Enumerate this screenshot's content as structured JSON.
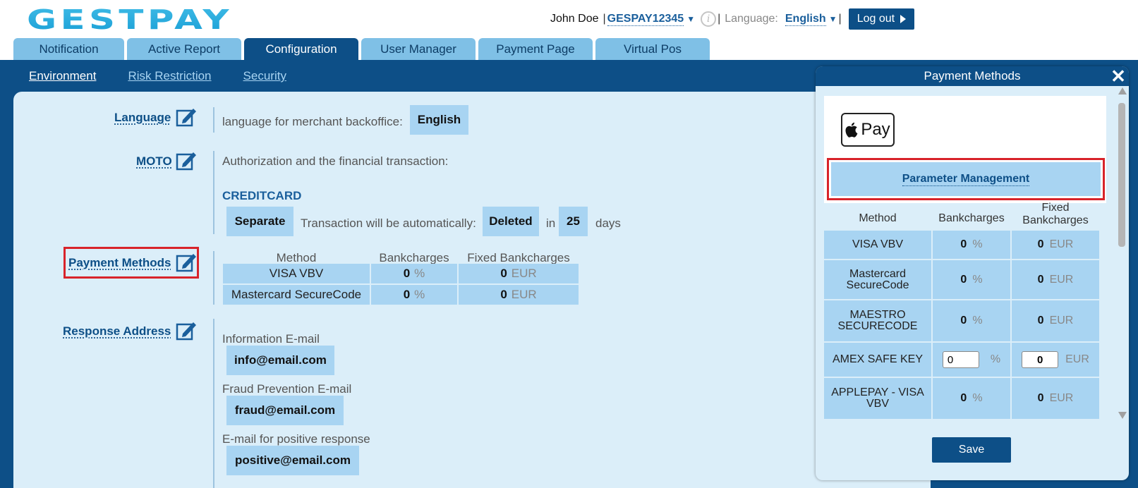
{
  "header": {
    "logo_text": "GESTPAY",
    "user_name": "John Doe",
    "shop_code": "GESPAY12345",
    "language_label": "Language:",
    "language_value": "English",
    "logout_label": "Log out"
  },
  "tabs": [
    {
      "label": "Notification"
    },
    {
      "label": "Active Report"
    },
    {
      "label": "Configuration"
    },
    {
      "label": "User Manager"
    },
    {
      "label": "Payment Page"
    },
    {
      "label": "Virtual Pos"
    }
  ],
  "subnav": [
    {
      "label": "Environment"
    },
    {
      "label": "Risk Restriction"
    },
    {
      "label": "Security"
    }
  ],
  "sections": {
    "language": {
      "label": "Language",
      "description": "language for merchant backoffice:",
      "value": "English"
    },
    "moto": {
      "label": "MOTO",
      "description": "Authorization and the financial transaction:",
      "subtitle": "CREDITCARD",
      "mode": "Separate",
      "auto_text": "Transaction will be automatically:",
      "action": "Deleted",
      "in_text": "in",
      "days_value": "25",
      "days_text": "days"
    },
    "payment_methods": {
      "label": "Payment Methods",
      "headers": [
        "Method",
        "Bankcharges",
        "Fixed Bankcharges"
      ],
      "rows": [
        {
          "method": "VISA VBV",
          "charge": "0",
          "charge_unit": "%",
          "fixed": "0",
          "fixed_unit": "EUR"
        },
        {
          "method": "Mastercard SecureCode",
          "charge": "0",
          "charge_unit": "%",
          "fixed": "0",
          "fixed_unit": "EUR"
        }
      ]
    },
    "response_address": {
      "label": "Response Address",
      "info_label": "Information E-mail",
      "info_value": "info@email.com",
      "fraud_label": "Fraud Prevention E-mail",
      "fraud_value": "fraud@email.com",
      "positive_label": "E-mail for positive response",
      "positive_value": "positive@email.com"
    }
  },
  "modal": {
    "title": "Payment Methods",
    "close": "✕",
    "applepay_label": "Pay",
    "param_button": "Parameter Management",
    "headers": {
      "method": "Method",
      "bankcharges": "Bankcharges",
      "fixed": "Fixed Bankcharges"
    },
    "rows": [
      {
        "method": "VISA VBV",
        "charge": "0",
        "charge_unit": "%",
        "fixed": "0",
        "fixed_unit": "EUR"
      },
      {
        "method": "Mastercard SecureCode",
        "charge": "0",
        "charge_unit": "%",
        "fixed": "0",
        "fixed_unit": "EUR"
      },
      {
        "method": "MAESTRO SECURECODE",
        "charge": "0",
        "charge_unit": "%",
        "fixed": "0",
        "fixed_unit": "EUR"
      },
      {
        "method": "AMEX SAFE KEY",
        "charge": "0",
        "charge_unit": "%",
        "fixed": "0",
        "fixed_unit": "EUR"
      },
      {
        "method": "APPLEPAY - VISA VBV",
        "charge": "0",
        "charge_unit": "%",
        "fixed": "0",
        "fixed_unit": "EUR"
      }
    ],
    "save_label": "Save"
  },
  "colors": {
    "brand_blue": "#0d4f87",
    "tab_light": "#7fc0e6",
    "panel_bg": "#dbeef9",
    "pill_bg": "#a8d4f2",
    "highlight_red": "#d8232a"
  }
}
